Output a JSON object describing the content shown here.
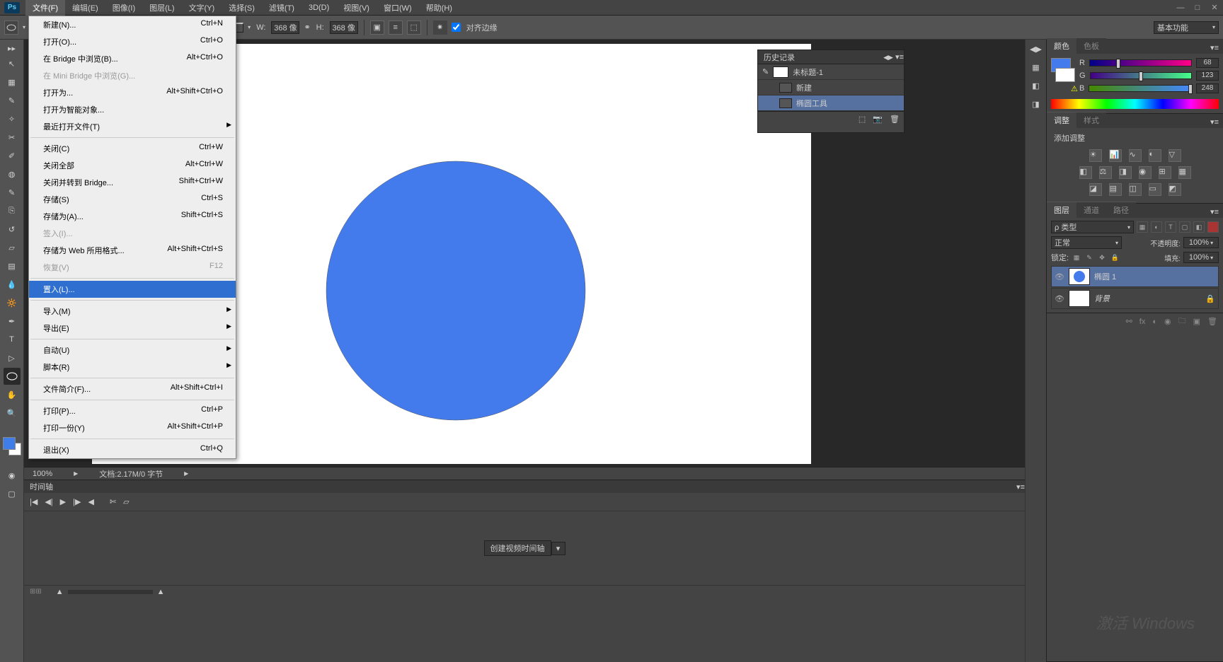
{
  "logo": "Ps",
  "menubar": {
    "items": [
      "文件(F)",
      "编辑(E)",
      "图像(I)",
      "图层(L)",
      "文字(Y)",
      "选择(S)",
      "滤镜(T)",
      "3D(D)",
      "视图(V)",
      "窗口(W)",
      "帮助(H)"
    ],
    "active": 0
  },
  "dropdown": [
    {
      "label": "新建(N)...",
      "shortcut": "Ctrl+N"
    },
    {
      "label": "打开(O)...",
      "shortcut": "Ctrl+O"
    },
    {
      "label": "在 Bridge 中浏览(B)...",
      "shortcut": "Alt+Ctrl+O"
    },
    {
      "label": "在 Mini Bridge 中浏览(G)...",
      "shortcut": "",
      "disabled": true
    },
    {
      "label": "打开为...",
      "shortcut": "Alt+Shift+Ctrl+O"
    },
    {
      "label": "打开为智能对象...",
      "shortcut": ""
    },
    {
      "label": "最近打开文件(T)",
      "shortcut": "",
      "submenu": true
    },
    {
      "sep": true
    },
    {
      "label": "关闭(C)",
      "shortcut": "Ctrl+W"
    },
    {
      "label": "关闭全部",
      "shortcut": "Alt+Ctrl+W"
    },
    {
      "label": "关闭并转到 Bridge...",
      "shortcut": "Shift+Ctrl+W"
    },
    {
      "label": "存储(S)",
      "shortcut": "Ctrl+S"
    },
    {
      "label": "存储为(A)...",
      "shortcut": "Shift+Ctrl+S"
    },
    {
      "label": "签入(I)...",
      "shortcut": "",
      "disabled": true
    },
    {
      "label": "存储为 Web 所用格式...",
      "shortcut": "Alt+Shift+Ctrl+S"
    },
    {
      "label": "恢复(V)",
      "shortcut": "F12",
      "disabled": true
    },
    {
      "sep": true
    },
    {
      "label": "置入(L)...",
      "shortcut": "",
      "hl": true
    },
    {
      "sep": true
    },
    {
      "label": "导入(M)",
      "shortcut": "",
      "submenu": true
    },
    {
      "label": "导出(E)",
      "shortcut": "",
      "submenu": true
    },
    {
      "sep": true
    },
    {
      "label": "自动(U)",
      "shortcut": "",
      "submenu": true
    },
    {
      "label": "脚本(R)",
      "shortcut": "",
      "submenu": true
    },
    {
      "sep": true
    },
    {
      "label": "文件简介(F)...",
      "shortcut": "Alt+Shift+Ctrl+I"
    },
    {
      "sep": true
    },
    {
      "label": "打印(P)...",
      "shortcut": "Ctrl+P"
    },
    {
      "label": "打印一份(Y)",
      "shortcut": "Alt+Shift+Ctrl+P"
    },
    {
      "sep": true
    },
    {
      "label": "退出(X)",
      "shortcut": "Ctrl+Q"
    }
  ],
  "optionsbar": {
    "w_label": "W:",
    "w_val": "368",
    "w_unit": "像",
    "link": "⚭",
    "h_label": "H:",
    "h_val": "368",
    "h_unit": "像",
    "align": "对齐边缘",
    "workspace": "基本功能"
  },
  "history": {
    "title": "历史记录",
    "doc": "未标题-1",
    "items": [
      "新建",
      "椭圆工具"
    ]
  },
  "color": {
    "tab1": "颜色",
    "tab2": "色板",
    "r": {
      "label": "R",
      "val": "68"
    },
    "g": {
      "label": "G",
      "val": "123"
    },
    "b": {
      "label": "B",
      "val": "248"
    }
  },
  "adjustments": {
    "tab1": "调整",
    "tab2": "样式",
    "add": "添加调整"
  },
  "layers": {
    "tab1": "图层",
    "tab2": "通道",
    "tab3": "路径",
    "filter": "ρ 类型",
    "mode": "正常",
    "opacity_label": "不透明度:",
    "opacity": "100%",
    "lock_label": "锁定:",
    "fill_label": "填充:",
    "fill": "100%",
    "items": [
      {
        "name": "椭圆 1",
        "sel": true,
        "thumb": "circle"
      },
      {
        "name": "背景",
        "sel": false,
        "locked": true
      }
    ]
  },
  "status": {
    "zoom": "100%",
    "doc": "文档:2.17M/0 字节"
  },
  "timeline": {
    "title": "时间轴",
    "create": "创建视频时间轴"
  },
  "watermark": "激活 Windows"
}
